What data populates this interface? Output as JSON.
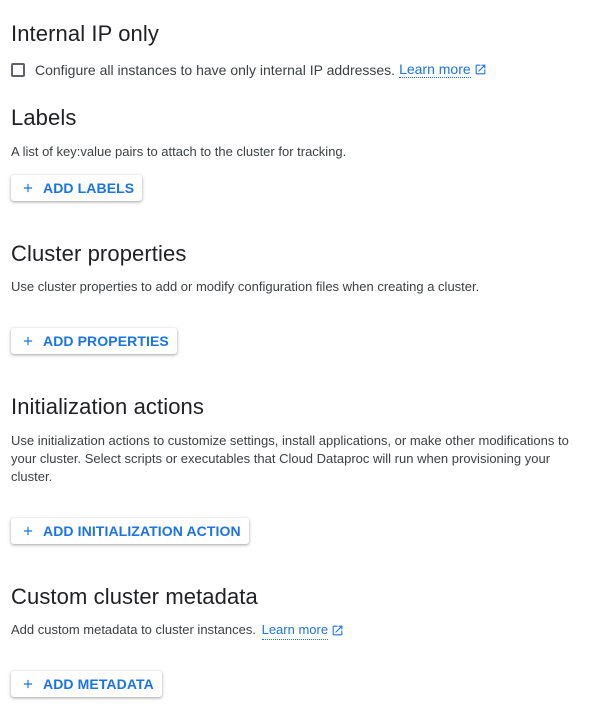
{
  "internal_ip": {
    "title": "Internal IP only",
    "checkbox_label": "Configure all instances to have only internal IP addresses.",
    "learn_more": "Learn more",
    "checked": false
  },
  "labels": {
    "title": "Labels",
    "description": "A list of key:value pairs to attach to the cluster for tracking.",
    "button": "ADD LABELS"
  },
  "cluster_properties": {
    "title": "Cluster properties",
    "description": "Use cluster properties to add or modify configuration files when creating a cluster.",
    "button": "ADD PROPERTIES"
  },
  "initialization_actions": {
    "title": "Initialization actions",
    "description": "Use initialization actions to customize settings, install applications, or make other modifications to your cluster. Select scripts or executables that Cloud Dataproc will run when provisioning your cluster.",
    "button": "ADD INITIALIZATION ACTION"
  },
  "custom_metadata": {
    "title": "Custom cluster metadata",
    "description": "Add custom metadata to cluster instances.",
    "learn_more": "Learn more",
    "button": "ADD METADATA"
  },
  "icons": {
    "add": "plus-icon",
    "external_link": "open-in-new-icon"
  },
  "colors": {
    "accent": "#1a73e8",
    "text": "#202124",
    "secondary_text": "#3c4043"
  }
}
